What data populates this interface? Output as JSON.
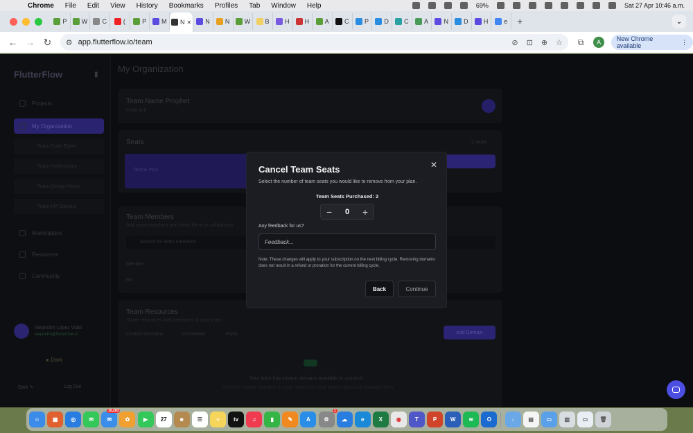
{
  "menubar": {
    "app": "Chrome",
    "items": [
      "File",
      "Edit",
      "View",
      "History",
      "Bookmarks",
      "Profiles",
      "Tab",
      "Window",
      "Help"
    ],
    "battery": "69%",
    "datetime": "Sat 27 Apr  10:46 a.m."
  },
  "tabs": [
    {
      "label": "P",
      "color": "#5a9e3a"
    },
    {
      "label": "W",
      "color": "#5a9e3a"
    },
    {
      "label": "C",
      "color": "#888"
    },
    {
      "label": "(",
      "color": "#e22"
    },
    {
      "label": "P",
      "color": "#5a9e3a"
    },
    {
      "label": "M",
      "color": "#5b4be0"
    },
    {
      "label": "N",
      "color": "#333",
      "active": true
    },
    {
      "label": "N",
      "color": "#5b4be0"
    },
    {
      "label": "N",
      "color": "#e8a020"
    },
    {
      "label": "W",
      "color": "#5a9e3a"
    },
    {
      "label": "B",
      "color": "#f0d060"
    },
    {
      "label": "H",
      "color": "#7a5ae0"
    },
    {
      "label": "H",
      "color": "#c33"
    },
    {
      "label": "A",
      "color": "#5a9e3a"
    },
    {
      "label": "C",
      "color": "#111"
    },
    {
      "label": "P",
      "color": "#2a8de0"
    },
    {
      "label": "D",
      "color": "#2a8de0"
    },
    {
      "label": "C",
      "color": "#2aa0a0"
    },
    {
      "label": "A",
      "color": "#4a9a5a"
    },
    {
      "label": "N",
      "color": "#5b4be0"
    },
    {
      "label": "D",
      "color": "#2a8de0"
    },
    {
      "label": "H",
      "color": "#5b4be0"
    },
    {
      "label": "e",
      "color": "#4285f4"
    }
  ],
  "toolbar": {
    "url": "app.flutterflow.io/team",
    "avatar_letter": "A",
    "new_chrome_label": "New Chrome available"
  },
  "sidebar": {
    "logo": "FlutterFlow",
    "items": [
      "Projects",
      "My Organization"
    ],
    "sub_items": [
      "Team Code Editor",
      "Team Preferences",
      "Team Design Views",
      "Team API Options"
    ],
    "more_items": [
      "Marketplace",
      "Resources",
      "Community"
    ],
    "profile_name": "Alejandro Lopez Vidal",
    "profile_sub": "alejandro@flutterflow.io",
    "theme_label": "Dark",
    "footer_left": "Dark ✎",
    "footer_right": "Log Out"
  },
  "main": {
    "page_title": "My Organization",
    "team_name": "Team Name Prophet",
    "team_sub": "Invite link",
    "seats_title": "Seats",
    "seats_right": "2 seats",
    "plan_label": "Teams Plan",
    "members_title": "Team Members",
    "members_sub": "Add team members and invite them to collaborate",
    "search_placeholder": "Search for team members",
    "member_label": "Member",
    "member_name": "Ra",
    "resources_title": "Team Resources",
    "resources_sub": "Share resources with members of your team",
    "resource_tabs": [
      "Custom Domains",
      "Connected",
      "Fonts"
    ],
    "add_btn": "Add Domain",
    "empty_title": "Your team has custom domains available to connect!",
    "empty_sub": "Connect custom domains to your team from your team's plan and manage them"
  },
  "dialog": {
    "title": "Cancel Team Seats",
    "description": "Select the number of team seats you would like to remove from your plan.",
    "purchased_label": "Team Seats Purchased:  2",
    "stepper_minus": "−",
    "stepper_value": "0",
    "stepper_plus": "+",
    "feedback_label": "Any feedback for us?",
    "feedback_placeholder": "Feedback...",
    "note": "Note: These changes will apply to your subscription on the next billing cycle. Removing domains does not result in a refund or proration for the current billing cycle.",
    "back_label": "Back",
    "continue_label": "Continue",
    "close_glyph": "✕"
  },
  "dock": {
    "icons": [
      {
        "name": "finder",
        "color": "#3b8be8",
        "glyph": "☺"
      },
      {
        "name": "launchpad",
        "color": "#e06030",
        "glyph": "▦"
      },
      {
        "name": "safari",
        "color": "#2a7de0",
        "glyph": "◎"
      },
      {
        "name": "messages",
        "color": "#34c759",
        "glyph": "✉"
      },
      {
        "name": "mail",
        "color": "#3a8de8",
        "glyph": "✉",
        "badge": "10,283"
      },
      {
        "name": "photos",
        "color": "#f0a030",
        "glyph": "✿"
      },
      {
        "name": "facetime",
        "color": "#34c759",
        "glyph": "▶"
      },
      {
        "name": "calendar",
        "color": "#ffffff",
        "glyph": "27",
        "text": "#222"
      },
      {
        "name": "contacts",
        "color": "#b58a50",
        "glyph": "☻"
      },
      {
        "name": "reminders",
        "color": "#ffffff",
        "glyph": "☰",
        "text": "#555"
      },
      {
        "name": "notes",
        "color": "#f5d65a",
        "glyph": "≡"
      },
      {
        "name": "tv",
        "color": "#111111",
        "glyph": "tv"
      },
      {
        "name": "music",
        "color": "#f03a50",
        "glyph": "♫"
      },
      {
        "name": "numbers",
        "color": "#34b545",
        "glyph": "▮"
      },
      {
        "name": "pages",
        "color": "#f08a20",
        "glyph": "✎"
      },
      {
        "name": "appstore",
        "color": "#2a8de8",
        "glyph": "A"
      },
      {
        "name": "settings",
        "color": "#888888",
        "glyph": "⚙",
        "badge": "1"
      },
      {
        "name": "onedrive",
        "color": "#2a7de0",
        "glyph": "☁"
      },
      {
        "name": "edge",
        "color": "#1a8ad8",
        "glyph": "e"
      },
      {
        "name": "excel",
        "color": "#1d7a42",
        "glyph": "X"
      },
      {
        "name": "chrome",
        "color": "#e8e8e8",
        "glyph": "◉",
        "text": "#d33"
      },
      {
        "name": "teams",
        "color": "#5058c8",
        "glyph": "T"
      },
      {
        "name": "powerpoint",
        "color": "#d0452a",
        "glyph": "P"
      },
      {
        "name": "word",
        "color": "#2b5fb8",
        "glyph": "W"
      },
      {
        "name": "spotify",
        "color": "#1db954",
        "glyph": "≋"
      },
      {
        "name": "outlook",
        "color": "#1a6ad0",
        "glyph": "O"
      },
      {
        "name": "downloads",
        "color": "#6aa8e8",
        "glyph": "↓"
      },
      {
        "name": "document",
        "color": "#f4f4f4",
        "glyph": "▤",
        "text": "#555"
      },
      {
        "name": "folder",
        "color": "#5aa0e8",
        "glyph": "▭"
      },
      {
        "name": "preview",
        "color": "#d8dde2",
        "glyph": "▥",
        "text": "#555"
      },
      {
        "name": "screenshot",
        "color": "#e8eef4",
        "glyph": "▭",
        "text": "#555"
      },
      {
        "name": "trash",
        "color": "#cfd3d8",
        "glyph": "🗑",
        "text": "#555"
      }
    ]
  }
}
